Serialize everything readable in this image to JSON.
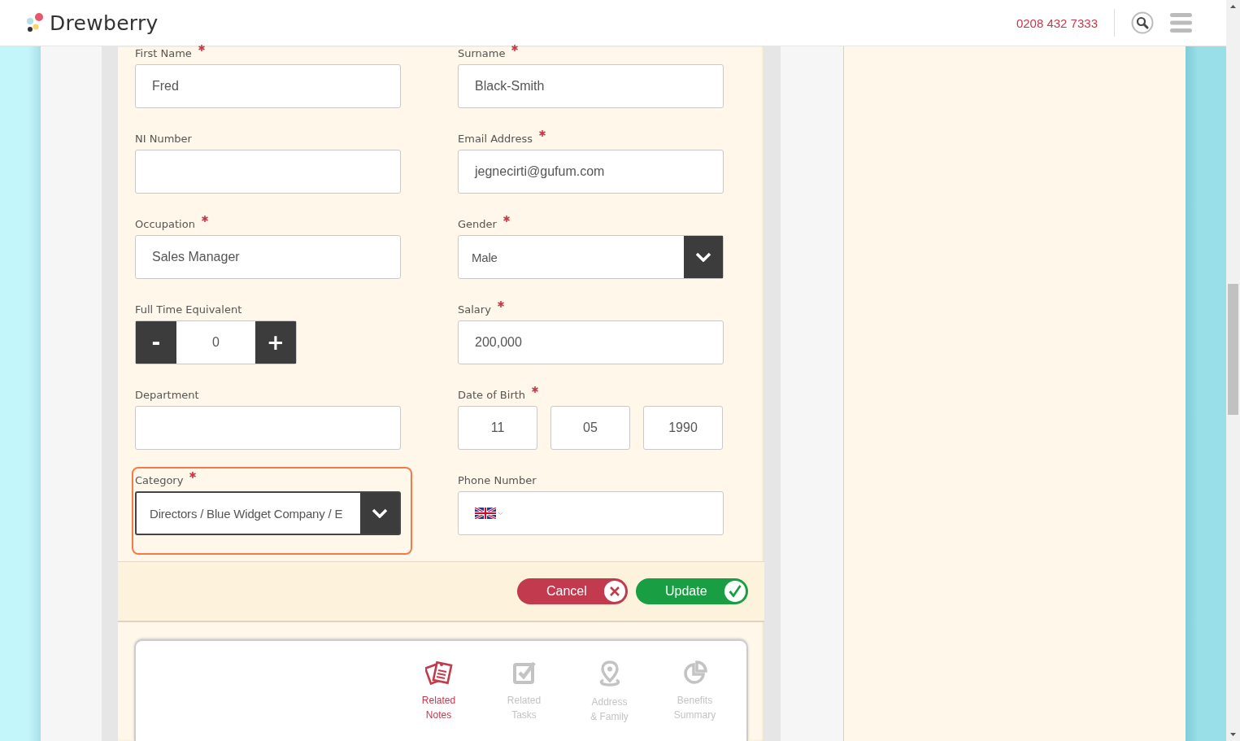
{
  "header": {
    "brand": "Drewberry",
    "phone": "0208 432 7333"
  },
  "fields": [
    {
      "kind": "text",
      "label": "First Name",
      "required": true,
      "value": "Fred",
      "focused": false
    },
    {
      "kind": "text",
      "label": "Surname",
      "required": true,
      "value": "Black-Smith",
      "focused": false
    },
    {
      "kind": "text",
      "label": "NI Number",
      "required": false,
      "focused": false
    },
    {
      "kind": "text",
      "label": "Email Address",
      "required": true,
      "value": "jegnecirti@gufum.com",
      "focused": false
    },
    {
      "kind": "text",
      "label": "Occupation",
      "required": true,
      "value": "Sales Manager",
      "focused": false
    },
    {
      "kind": "select",
      "label": "Gender",
      "required": true,
      "value": "Male",
      "focused": false
    },
    {
      "kind": "stepper",
      "label": "Full Time Equivalent",
      "required": false,
      "value": "0",
      "minus": "-",
      "plus": "+",
      "focused": false
    },
    {
      "kind": "text",
      "label": "Salary",
      "required": true,
      "value": "200,000",
      "focused": false
    },
    {
      "kind": "text",
      "label": "Department",
      "required": false,
      "focused": false
    },
    {
      "kind": "date",
      "label": "Date of Birth",
      "required": true,
      "parts": [
        "11",
        "05",
        "1990"
      ],
      "focused": false
    },
    {
      "kind": "select",
      "label": "Category",
      "required": true,
      "value": "Directors / Blue Widget Company / E",
      "focused": true
    },
    {
      "kind": "phone",
      "label": "Phone Number",
      "required": false,
      "focused": false
    }
  ],
  "buttons": [
    {
      "kind": "cancel",
      "label": "Cancel"
    },
    {
      "kind": "update",
      "label": "Update"
    }
  ],
  "tabs": [
    {
      "kind": "notes",
      "line1": "Related",
      "line2": "Notes",
      "selected": true
    },
    {
      "kind": "tasks",
      "line1": "Related",
      "line2": "Tasks",
      "selected": false
    },
    {
      "kind": "address",
      "line1": "Address",
      "line2": "& Family",
      "selected": false
    },
    {
      "kind": "benefits",
      "line1": "Benefits",
      "line2": "Summary",
      "selected": false
    }
  ]
}
